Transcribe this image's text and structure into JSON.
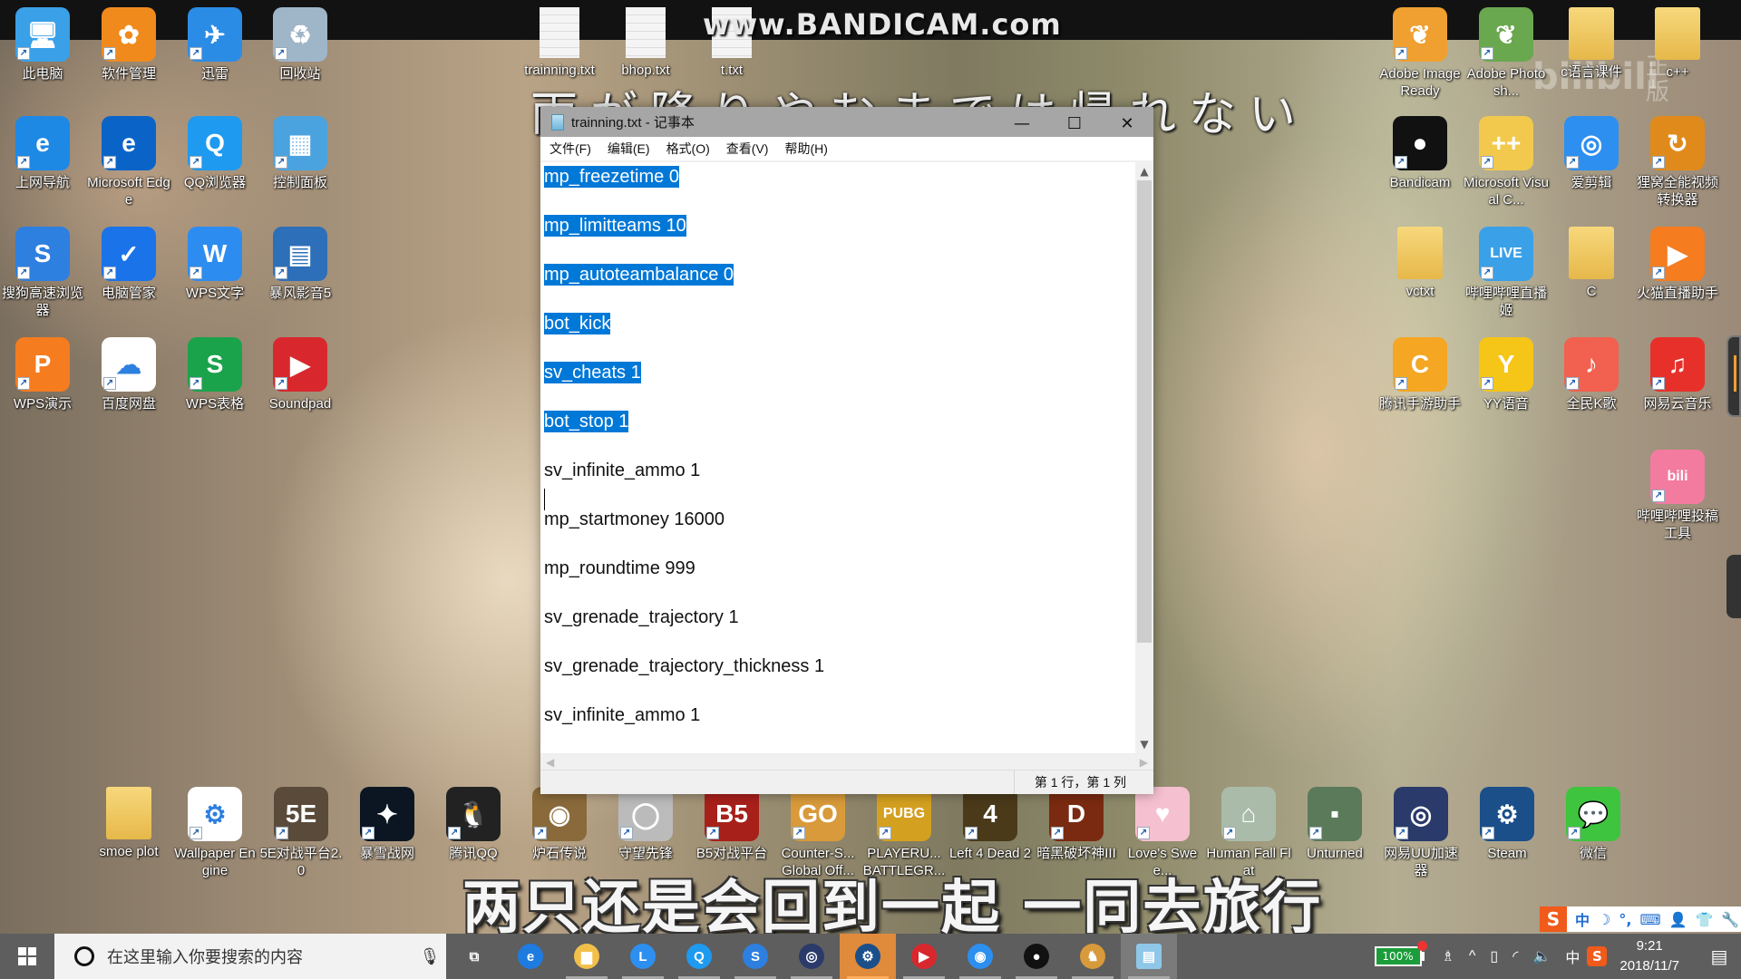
{
  "overlay": {
    "watermark": "www.BANDICAM.com",
    "lyric_top": "雨が降りやむまでは帰れない",
    "lyric_bottom": "两只还是会回到一起 一同去旅行",
    "bili_watermark": "bilibili",
    "bili_zhengban": "正版"
  },
  "desktop_icons": {
    "top_files": [
      {
        "label": "trainning.txt",
        "icon": "text-file-icon"
      },
      {
        "label": "bhop.txt",
        "icon": "text-file-icon"
      },
      {
        "label": "t.txt",
        "icon": "text-file-icon"
      }
    ],
    "left_grid": [
      {
        "label": "此电脑",
        "icon": "computer-icon",
        "color": "#3aa0e8",
        "glyph": "🖥"
      },
      {
        "label": "软件管理",
        "icon": "software-manager-icon",
        "color": "#f08a1c",
        "glyph": "✿"
      },
      {
        "label": "迅雷",
        "icon": "xunlei-icon",
        "color": "#2b8ce6",
        "glyph": "✈"
      },
      {
        "label": "回收站",
        "icon": "recycle-bin-icon",
        "color": "#9fb5c8",
        "glyph": "♻"
      },
      {
        "label": "上网导航",
        "icon": "ie-icon",
        "color": "#1e88e5",
        "glyph": "e"
      },
      {
        "label": "Microsoft Edge",
        "icon": "edge-icon",
        "color": "#0a64c8",
        "glyph": "e"
      },
      {
        "label": "QQ浏览器",
        "icon": "qq-browser-icon",
        "color": "#1e9af0",
        "glyph": "Q"
      },
      {
        "label": "控制面板",
        "icon": "control-panel-icon",
        "color": "#4aa3df",
        "glyph": "▦"
      },
      {
        "label": "搜狗高速浏览器",
        "icon": "sogou-browser-icon",
        "color": "#2d7fe0",
        "glyph": "S"
      },
      {
        "label": "电脑管家",
        "icon": "pc-manager-icon",
        "color": "#1a73e8",
        "glyph": "✓"
      },
      {
        "label": "WPS文字",
        "icon": "wps-writer-icon",
        "color": "#2d8cf0",
        "glyph": "W"
      },
      {
        "label": "暴风影音5",
        "icon": "baofeng-icon",
        "color": "#2d6fb8",
        "glyph": "▤"
      },
      {
        "label": "WPS演示",
        "icon": "wps-presentation-icon",
        "color": "#f57c1f",
        "glyph": "P"
      },
      {
        "label": "百度网盘",
        "icon": "baidu-netdisk-icon",
        "color": "#ffffff",
        "glyph": "☁"
      },
      {
        "label": "WPS表格",
        "icon": "wps-spreadsheet-icon",
        "color": "#1aa34a",
        "glyph": "S"
      },
      {
        "label": "Soundpad",
        "icon": "soundpad-icon",
        "color": "#d8282e",
        "glyph": "▶"
      }
    ],
    "right_grid": [
      {
        "label": "Adobe ImageReady",
        "icon": "adobe-imageready-icon",
        "color": "#f0a030",
        "glyph": "❦"
      },
      {
        "label": "Adobe Photosh...",
        "icon": "adobe-photoshop-icon",
        "color": "#6aa84f",
        "glyph": "❦"
      },
      {
        "label": "c语言课件",
        "icon": "folder-icon",
        "color": "folder",
        "glyph": ""
      },
      {
        "label": "c++",
        "icon": "folder-icon",
        "color": "folder",
        "glyph": ""
      },
      {
        "label": "Bandicam",
        "icon": "bandicam-icon",
        "color": "#111111",
        "glyph": "●"
      },
      {
        "label": "Microsoft Visual C...",
        "icon": "visual-cpp-icon",
        "color": "#f2c94c",
        "glyph": "++"
      },
      {
        "label": "爱剪辑",
        "icon": "aijianji-icon",
        "color": "#2d8ff0",
        "glyph": "◎"
      },
      {
        "label": "狸窝全能视频转换器",
        "icon": "liwo-converter-icon",
        "color": "#e08a1c",
        "glyph": "↻"
      },
      {
        "label": "vctxt",
        "icon": "folder-icon",
        "color": "folder",
        "glyph": ""
      },
      {
        "label": "哔哩哔哩直播姬",
        "icon": "bilibili-live-icon",
        "color": "#3aa0e8",
        "glyph": "LIVE"
      },
      {
        "label": "C",
        "icon": "folder-icon",
        "color": "folder",
        "glyph": ""
      },
      {
        "label": "火猫直播助手",
        "icon": "huomao-icon",
        "color": "#f57c1f",
        "glyph": "▶"
      },
      {
        "label": "腾讯手游助手",
        "icon": "tencent-mobile-games-icon",
        "color": "#f5a623",
        "glyph": "C"
      },
      {
        "label": "YY语音",
        "icon": "yy-voice-icon",
        "color": "#f5c518",
        "glyph": "Y"
      },
      {
        "label": "全民K歌",
        "icon": "kge-icon",
        "color": "#f2604f",
        "glyph": "♪"
      },
      {
        "label": "网易云音乐",
        "icon": "netease-music-icon",
        "color": "#e8302a",
        "glyph": "♫"
      },
      {
        "label": "哔哩哔哩投稿工具",
        "icon": "bilibili-upload-icon",
        "color": "#f37ba0",
        "glyph": "bili"
      }
    ],
    "bottom_row": [
      {
        "label": "smoe plot",
        "icon": "folder-icon",
        "color": "folder",
        "glyph": ""
      },
      {
        "label": "Wallpaper Engine",
        "icon": "wallpaper-engine-icon",
        "color": "#ffffff",
        "glyph": "⚙"
      },
      {
        "label": "5E对战平台2.0",
        "icon": "5e-platform-icon",
        "color": "#5a4a3a",
        "glyph": "5E"
      },
      {
        "label": "暴雪战网",
        "icon": "battlenet-icon",
        "color": "#0b1622",
        "glyph": "✦"
      },
      {
        "label": "腾讯QQ",
        "icon": "qq-icon",
        "color": "#222222",
        "glyph": "🐧"
      },
      {
        "label": "炉石传说",
        "icon": "hearthstone-icon",
        "color": "#8a6a3a",
        "glyph": "◉"
      },
      {
        "label": "守望先锋",
        "icon": "overwatch-icon",
        "color": "#bbbbbb",
        "glyph": "◯"
      },
      {
        "label": "B5对战平台",
        "icon": "b5-platform-icon",
        "color": "#a8201a",
        "glyph": "B5"
      },
      {
        "label": "Counter-S... Global Off...",
        "icon": "csgo-icon",
        "color": "#d89a3a",
        "glyph": "GO"
      },
      {
        "label": "PLAYERU... BATTLEGR...",
        "icon": "pubg-icon",
        "color": "#d4a020",
        "glyph": "PUBG"
      },
      {
        "label": "Left 4 Dead 2",
        "icon": "l4d2-icon",
        "color": "#4a3a1a",
        "glyph": "4"
      },
      {
        "label": "暗黑破坏神III",
        "icon": "diablo3-icon",
        "color": "#7a2a10",
        "glyph": "D"
      },
      {
        "label": "Love's Swee...",
        "icon": "loves-sweet-icon",
        "color": "#f5c0d0",
        "glyph": "♥"
      },
      {
        "label": "Human Fall Flat",
        "icon": "human-fall-flat-icon",
        "color": "#aabbaa",
        "glyph": "⌂"
      },
      {
        "label": "Unturned",
        "icon": "unturned-icon",
        "color": "#5a7a5a",
        "glyph": "▪"
      },
      {
        "label": "网易UU加速器",
        "icon": "uu-accelerator-icon",
        "color": "#2a3a6a",
        "glyph": "◎"
      },
      {
        "label": "Steam",
        "icon": "steam-icon",
        "color": "#1b4f8a",
        "glyph": "⚙"
      },
      {
        "label": "微信",
        "icon": "wechat-icon",
        "color": "#3ec43e",
        "glyph": "💬"
      }
    ]
  },
  "notepad": {
    "title": "trainning.txt - 记事本",
    "controls": {
      "minimize": "—",
      "maximize": "☐",
      "close": "✕"
    },
    "menu": [
      "文件(F)",
      "编辑(E)",
      "格式(O)",
      "查看(V)",
      "帮助(H)"
    ],
    "lines": [
      {
        "text": "mp_freezetime 0",
        "selected": true
      },
      {
        "text": "mp_limitteams 10",
        "selected": true
      },
      {
        "text": "mp_autoteambalance 0",
        "selected": true
      },
      {
        "text": "bot_kick",
        "selected": true
      },
      {
        "text": "sv_cheats 1",
        "selected": true
      },
      {
        "text": "bot_stop 1",
        "selected": true
      },
      {
        "text": "sv_infinite_ammo 1",
        "selected": false
      },
      {
        "text": "mp_startmoney 16000",
        "selected": false
      },
      {
        "text": "mp_roundtime 999",
        "selected": false
      },
      {
        "text": "sv_grenade_trajectory 1",
        "selected": false
      },
      {
        "text": "sv_grenade_trajectory_thickness 1",
        "selected": false
      },
      {
        "text": "sv_infinite_ammo 1",
        "selected": false
      }
    ],
    "status": "第 1 行，第 1 列"
  },
  "taskbar": {
    "search_placeholder": "在这里输入你要搜索的内容",
    "apps": [
      {
        "name": "task-view",
        "glyph": "⧉",
        "color": "transparent",
        "state": ""
      },
      {
        "name": "edge",
        "glyph": "e",
        "color": "#1e7be0",
        "state": ""
      },
      {
        "name": "file-explorer",
        "glyph": "▆",
        "color": "#f2c04a",
        "state": "running"
      },
      {
        "name": "clock-app",
        "glyph": "L",
        "color": "#2d8ff0",
        "state": "running"
      },
      {
        "name": "qq-browser",
        "glyph": "Q",
        "color": "#1e9af0",
        "state": "running"
      },
      {
        "name": "sogou-browser",
        "glyph": "S",
        "color": "#2d7fe0",
        "state": "running"
      },
      {
        "name": "uu-accelerator",
        "glyph": "◎",
        "color": "#2a3a6a",
        "state": "running"
      },
      {
        "name": "steam",
        "glyph": "⚙",
        "color": "#1b4f8a",
        "state": "active"
      },
      {
        "name": "soundpad",
        "glyph": "▶",
        "color": "#d8282e",
        "state": "running"
      },
      {
        "name": "aijianji",
        "glyph": "◉",
        "color": "#2d8ff0",
        "state": "running"
      },
      {
        "name": "bandicam",
        "glyph": "●",
        "color": "#111111",
        "state": "running"
      },
      {
        "name": "csgo",
        "glyph": "♞",
        "color": "#d89a3a",
        "state": "running"
      },
      {
        "name": "notepad",
        "glyph": "▤",
        "color": "#8fc7e8",
        "state": "notepad"
      }
    ],
    "tray": {
      "battery": "100%",
      "people": "♗",
      "chevron": "^",
      "ime_lang": "中",
      "ime_s": "S",
      "time": "9:21",
      "date": "2018/11/7",
      "notification": "▤"
    },
    "ime_bar": [
      "S",
      "中",
      "☽",
      "°,",
      "⌨",
      "👤",
      "👕",
      "🔧"
    ]
  }
}
